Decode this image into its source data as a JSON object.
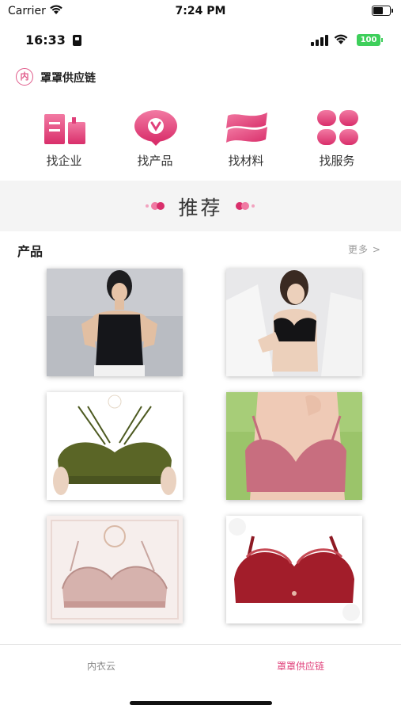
{
  "sim_status": {
    "carrier": "Carrier",
    "time": "7:24 PM",
    "battery_level": 0.65
  },
  "app_status": {
    "time": "16:33",
    "battery": "100"
  },
  "brand": {
    "logo_char": "内",
    "name": "罩罩供应链"
  },
  "categories": [
    {
      "label": "找企业",
      "icon": "building-icon"
    },
    {
      "label": "找产品",
      "icon": "product-badge-icon"
    },
    {
      "label": "找材料",
      "icon": "fabric-icon"
    },
    {
      "label": "找服务",
      "icon": "clover-icon"
    }
  ],
  "recommend": {
    "title": "推荐"
  },
  "products_section": {
    "title": "产品",
    "more": "更多 >"
  },
  "products": [
    {
      "name": "black-tank-top-model",
      "stamp": ""
    },
    {
      "name": "black-bra-model",
      "stamp": ""
    },
    {
      "name": "olive-strappy-bra",
      "stamp": ""
    },
    {
      "name": "pink-bra-model",
      "stamp": ""
    },
    {
      "name": "pink-lace-bra",
      "stamp": ""
    },
    {
      "name": "red-lace-bra",
      "stamp": ""
    }
  ],
  "tabbar": {
    "tabs": [
      {
        "label": "内衣云",
        "active": false
      },
      {
        "label": "罩罩供应链",
        "active": true
      }
    ]
  },
  "colors": {
    "accent": "#e0407a",
    "tab_inactive": "#8a8a8a",
    "battery_badge": "#3ecf5b"
  }
}
